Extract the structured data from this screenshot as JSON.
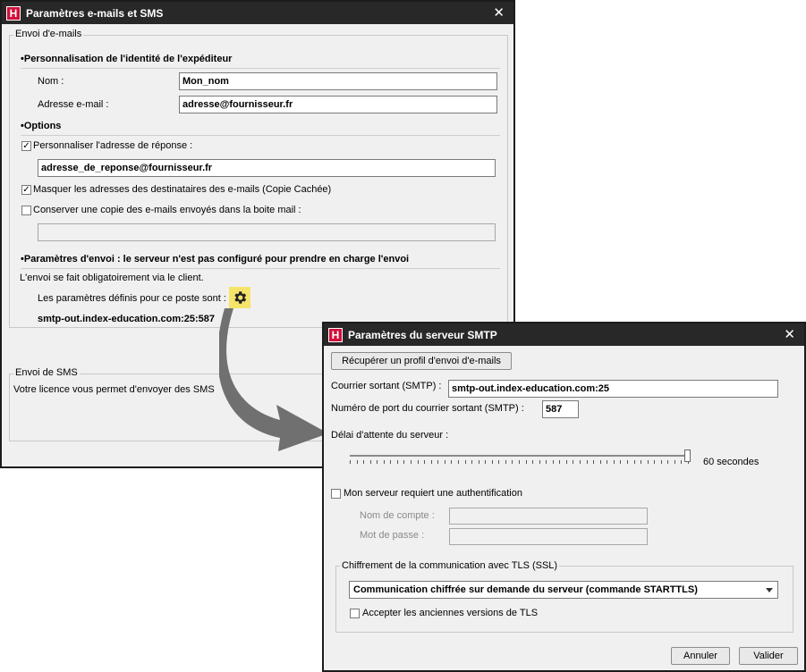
{
  "main_dialog": {
    "title": "Paramètres e-mails et SMS",
    "email_group": {
      "legend": "Envoi d'e-mails",
      "identity_section": "•Personnalisation de l'identité de l'expéditeur",
      "name_label": "Nom :",
      "name_value": "Mon_nom",
      "email_label": "Adresse e-mail :",
      "email_value": "adresse@fournisseur.fr",
      "options_section": "•Options",
      "reply_checkbox_label": "Personnaliser l'adresse de réponse :",
      "reply_checked": true,
      "reply_value": "adresse_de_reponse@fournisseur.fr",
      "bcc_checkbox_label": "Masquer les adresses des destinataires des e-mails (Copie Cachée)",
      "bcc_checked": true,
      "keep_copy_label": "Conserver une copie des e-mails envoyés dans la boite mail :",
      "keep_copy_checked": false,
      "keep_copy_value": "",
      "send_params_section": "•Paramètres d'envoi : le serveur n'est pas configuré pour prendre en charge l'envoi",
      "client_note": "L'envoi se fait obligatoirement via le client.",
      "poste_params_label": "Les paramètres définis pour ce poste sont :",
      "smtp_summary": "smtp-out.index-education.com:25:587"
    },
    "sms_group": {
      "legend": "Envoi de SMS",
      "text": "Votre licence vous permet d'envoyer des SMS"
    }
  },
  "smtp_dialog": {
    "title": "Paramètres du serveur SMTP",
    "retrieve_profile_button": "Récupérer un profil d'envoi d'e-mails",
    "outgoing_label": "Courrier sortant (SMTP) :",
    "outgoing_value": "smtp-out.index-education.com:25",
    "port_label": "Numéro de port du courrier sortant (SMTP) :",
    "port_value": "587",
    "timeout_label": "Délai d'attente du serveur :",
    "timeout_value_text": "60 secondes",
    "timeout_slider_fraction": 1.0,
    "auth_checkbox_label": "Mon serveur requiert une authentification",
    "auth_checked": false,
    "account_label": "Nom de compte :",
    "account_value": "",
    "password_label": "Mot de passe :",
    "password_value": "",
    "tls_group": {
      "legend": "Chiffrement de la communication avec TLS (SSL)",
      "selected_option": "Communication chiffrée sur demande du serveur (commande STARTTLS)",
      "old_tls_label": "Accepter les anciennes versions de TLS",
      "old_tls_checked": false
    },
    "cancel_button": "Annuler",
    "validate_button": "Valider"
  },
  "app_icon_letter": "H",
  "colors": {
    "titlebar": "#282828",
    "app_icon": "#d0103a",
    "gear_highlight": "#f5e46a",
    "arrow": "#707070"
  }
}
